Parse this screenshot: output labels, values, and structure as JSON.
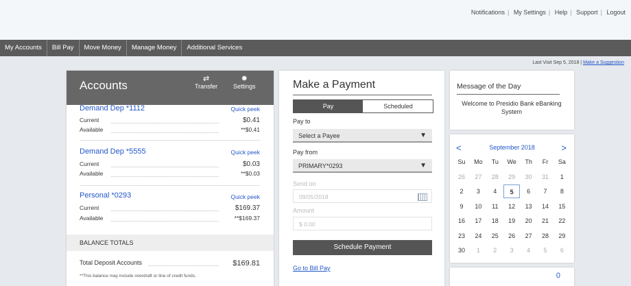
{
  "utility_nav": [
    "Notifications",
    "My Settings",
    "Help",
    "Support",
    "Logout"
  ],
  "main_nav": [
    "My Accounts",
    "Bill Pay",
    "Move Money",
    "Manage Money",
    "Additional Services"
  ],
  "last_visit": {
    "text": "Last Visit Sep 5, 2018 |",
    "link": "Make a Suggestion"
  },
  "accounts": {
    "title": "Accounts",
    "transfer_label": "Transfer",
    "settings_label": "Settings",
    "items": [
      {
        "name": "Demand Dep  *1112",
        "quick": "Quick peek",
        "current_label": "Current",
        "current": "$0.41",
        "available_label": "Available",
        "available": "**$0.41"
      },
      {
        "name": "Demand Dep  *5555",
        "quick": "Quick peek",
        "current_label": "Current",
        "current": "$0.03",
        "available_label": "Available",
        "available": "**$0.03"
      },
      {
        "name": "Personal  *0293",
        "quick": "Quick peek",
        "current_label": "Current",
        "current": "$169.37",
        "available_label": "Available",
        "available": "**$169.37"
      }
    ],
    "totals_header": "BALANCE TOTALS",
    "total_label": "Total Deposit Accounts",
    "total_value": "$169.81",
    "note": "**This balance may include overdraft or line of credit funds."
  },
  "payment": {
    "title": "Make a Payment",
    "tab_pay": "Pay",
    "tab_scheduled": "Scheduled",
    "pay_to_label": "Pay to",
    "pay_to_value": "Select a Payee",
    "pay_from_label": "Pay from",
    "pay_from_value": "PRIMARY*0293",
    "send_on_label": "Send on",
    "send_on_value": "09/05/2018",
    "amount_label": "Amount",
    "amount_placeholder": "$ 0.00",
    "schedule_button": "Schedule Payment",
    "bill_pay_link": "Go to Bill Pay"
  },
  "message": {
    "title": "Message of the Day",
    "body": "Welcome to Presidio Bank eBanking System"
  },
  "calendar": {
    "month": "September 2018",
    "prev": "<",
    "next": ">",
    "weekdays": [
      "Su",
      "Mo",
      "Tu",
      "We",
      "Th",
      "Fr",
      "Sa"
    ],
    "weeks": [
      [
        "26",
        "27",
        "28",
        "29",
        "30",
        "31",
        "1"
      ],
      [
        "2",
        "3",
        "4",
        "5",
        "6",
        "7",
        "8"
      ],
      [
        "9",
        "10",
        "11",
        "12",
        "13",
        "14",
        "15"
      ],
      [
        "16",
        "17",
        "18",
        "19",
        "20",
        "21",
        "22"
      ],
      [
        "23",
        "24",
        "25",
        "26",
        "27",
        "28",
        "29"
      ],
      [
        "30",
        "1",
        "2",
        "3",
        "4",
        "5",
        "6"
      ]
    ],
    "muted": [
      [
        0,
        0
      ],
      [
        0,
        1
      ],
      [
        0,
        2
      ],
      [
        0,
        3
      ],
      [
        0,
        4
      ],
      [
        0,
        5
      ],
      [
        5,
        1
      ],
      [
        5,
        2
      ],
      [
        5,
        3
      ],
      [
        5,
        4
      ],
      [
        5,
        5
      ],
      [
        5,
        6
      ]
    ],
    "selected": [
      1,
      3
    ]
  },
  "mini_card_value": "0"
}
